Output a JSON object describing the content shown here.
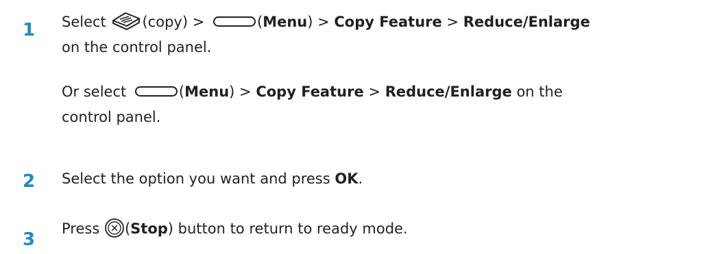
{
  "steps": [
    {
      "number": "1",
      "line1": {
        "select": "Select",
        "copy_icon": "copy-icon",
        "copy_paren": "(copy) >",
        "menu_icon": "menu-button-icon",
        "open_paren": "(",
        "menu": "Menu",
        "close_paren": ") >",
        "copy_feature": "Copy Feature",
        "sep": ">",
        "reduce_enlarge": "Reduce/Enlarge"
      },
      "line2": "on the control panel.",
      "alt": {
        "or_select": "Or select",
        "menu_icon": "menu-button-icon",
        "open_paren": "(",
        "menu": "Menu",
        "close_paren": ") >",
        "copy_feature": "Copy Feature",
        "sep": ">",
        "reduce_enlarge": "Reduce/Enlarge",
        "on_the": "on the",
        "line2": "control panel."
      }
    },
    {
      "number": "2",
      "text": "Select the option you want and press",
      "ok": "OK",
      "period": "."
    },
    {
      "number": "3",
      "press": "Press",
      "stop_icon": "stop-button-icon",
      "open_paren": "(",
      "stop": "Stop",
      "rest": ") button to return to ready mode."
    }
  ]
}
